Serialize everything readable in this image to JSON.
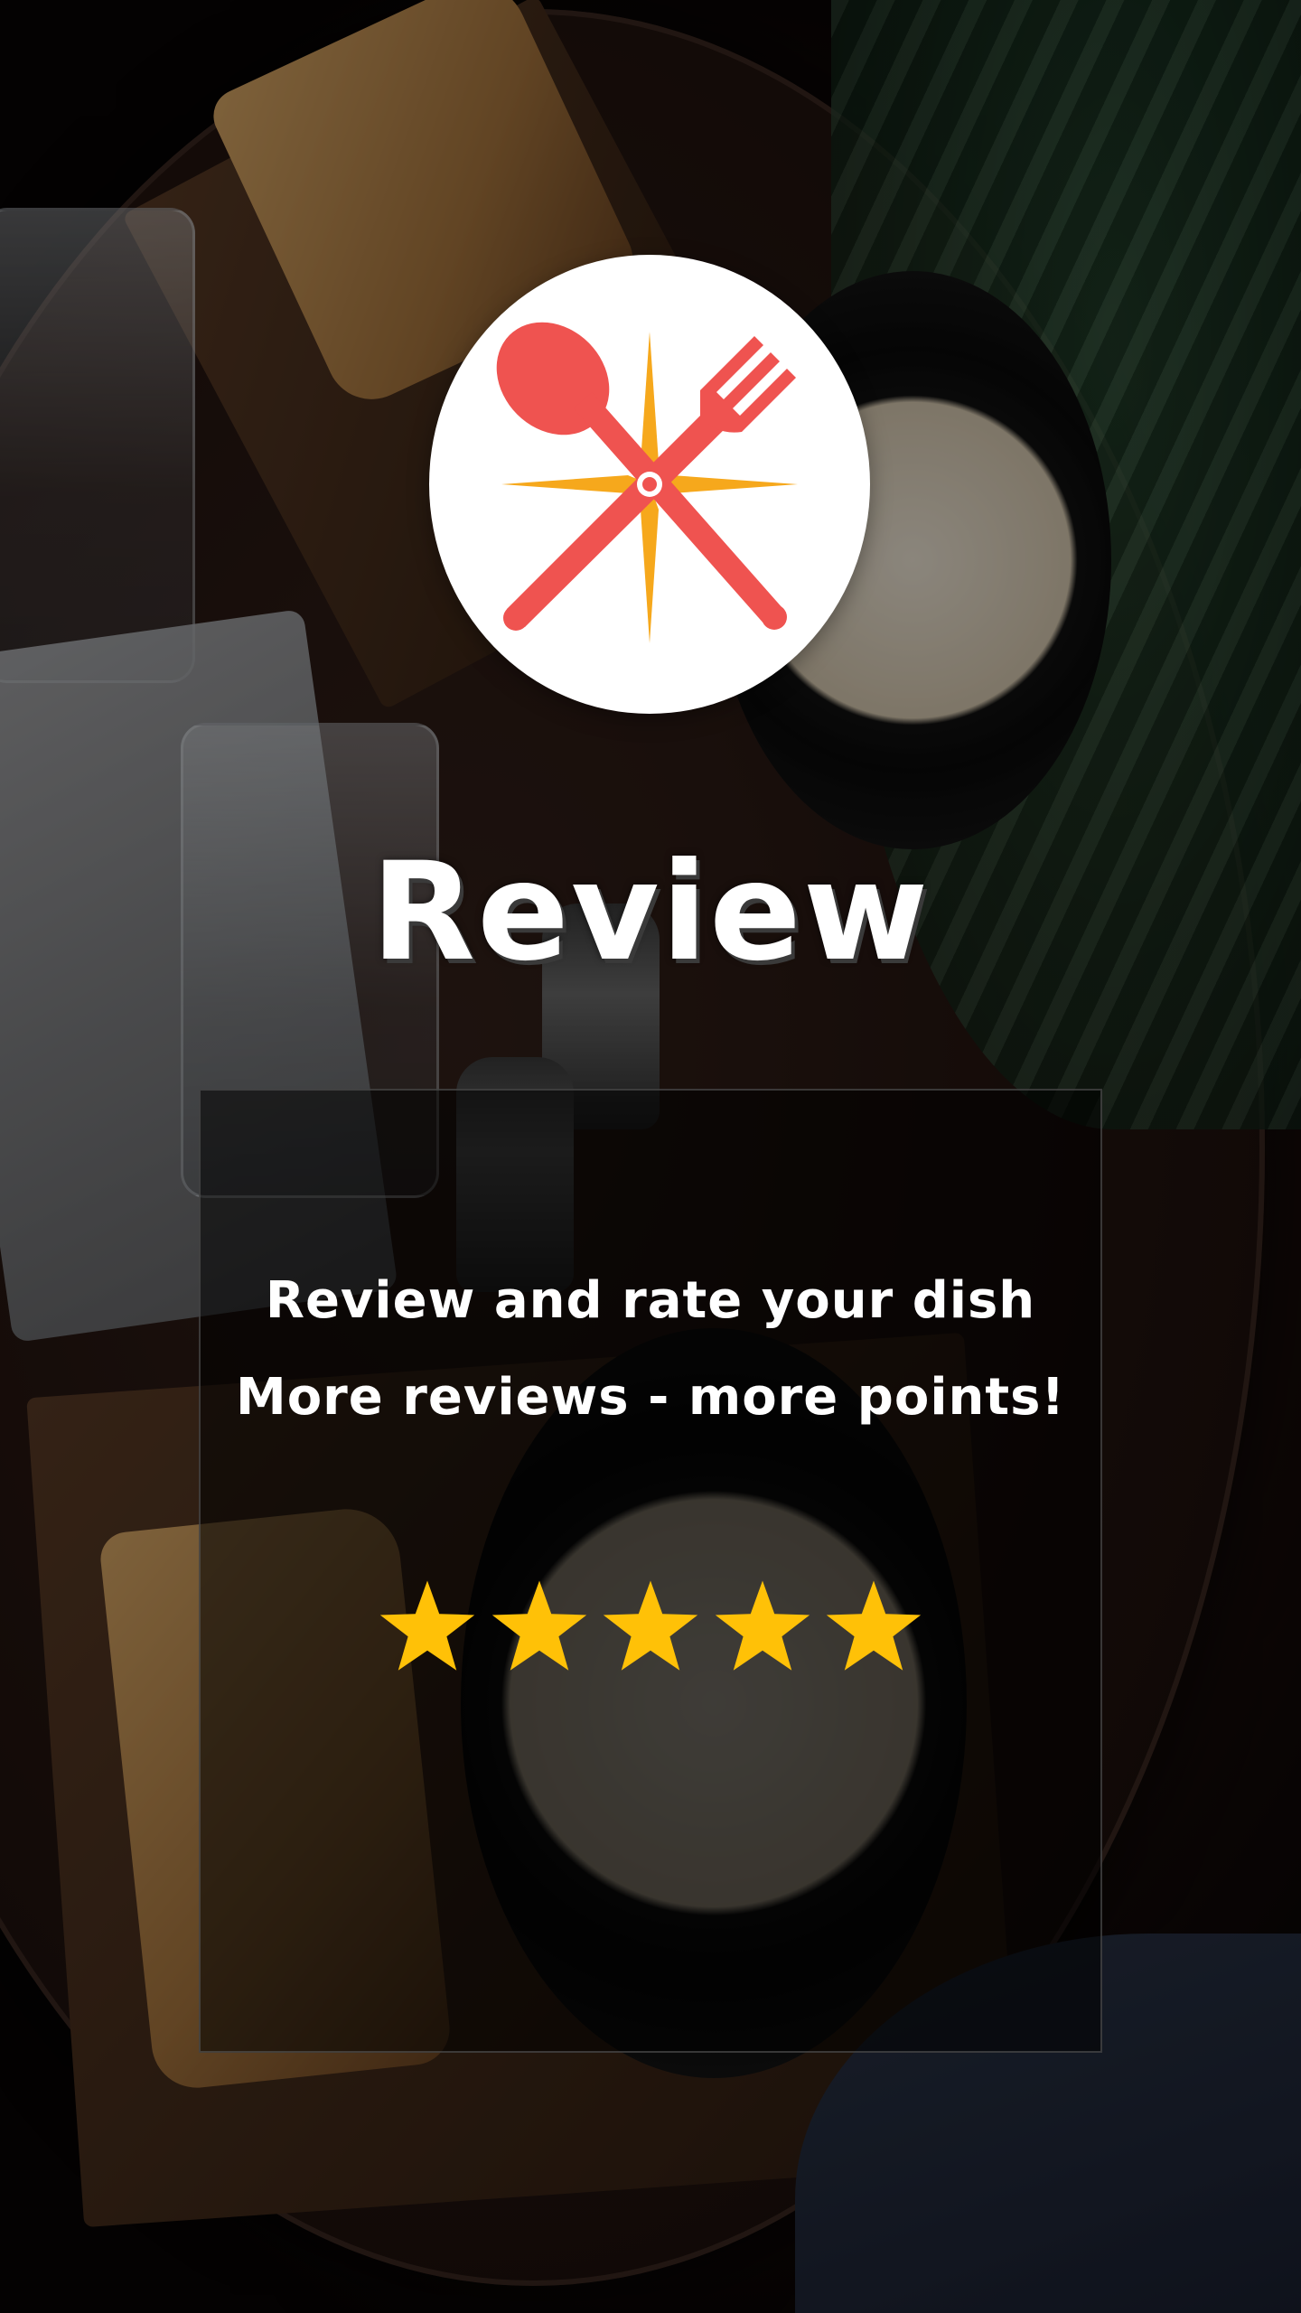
{
  "screen": {
    "title": "Review",
    "subtitle_line1": "Review and rate your dish",
    "subtitle_line2": "More reviews - more points!"
  },
  "logo": {
    "icon": "crossed-spoon-fork-icon",
    "spoon_fork_color": "#EF5350",
    "sparkle_color": "#F6A81C",
    "background_color": "#FFFFFF"
  },
  "rating": {
    "max_stars": 5,
    "selected_stars": 5,
    "star_icon": "star-icon",
    "star_color": "#FFC107"
  },
  "colors": {
    "title_text": "#FFFFFF",
    "title_shadow": "#3A3A3A",
    "card_background": "rgba(0,0,0,0.55)"
  }
}
